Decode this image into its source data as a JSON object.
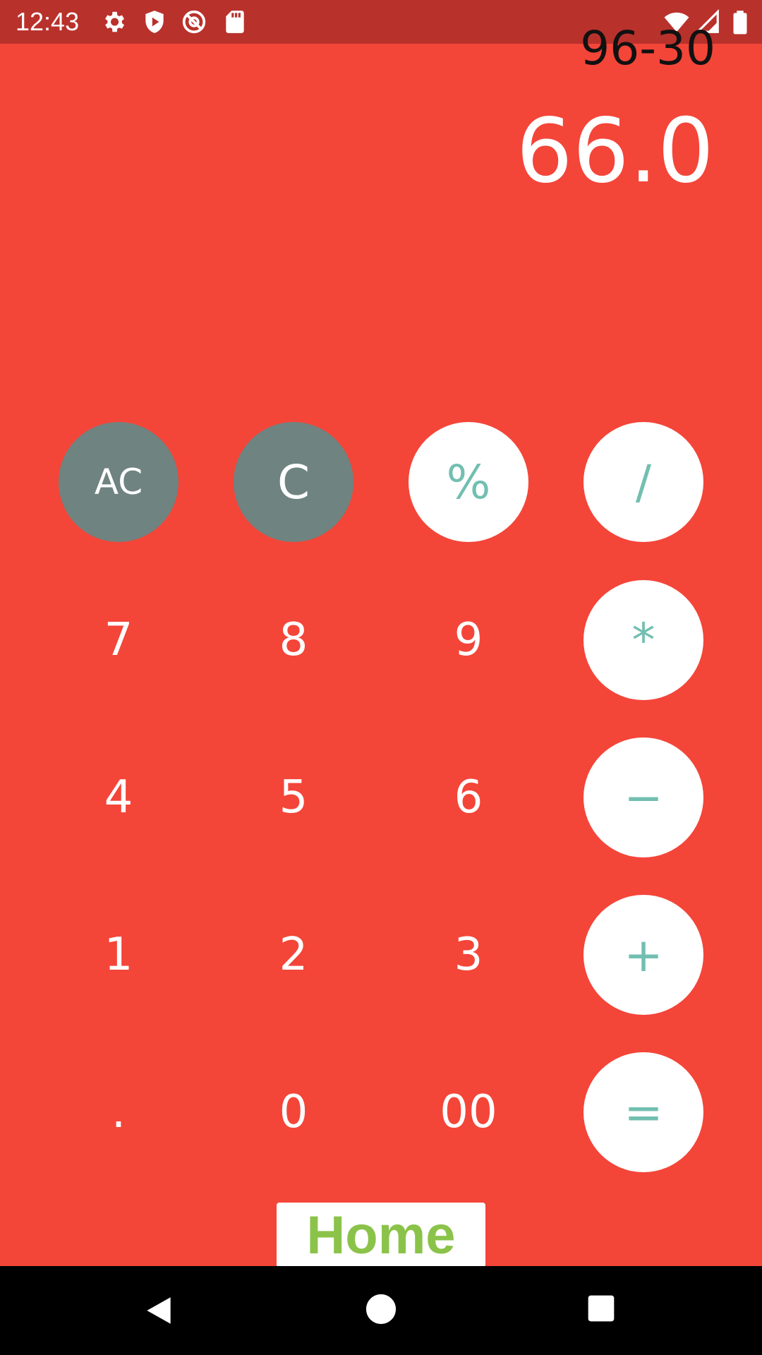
{
  "status_bar": {
    "time": "12:43",
    "left_icons": [
      "gear-icon",
      "shield-play-icon",
      "at-sign-icon",
      "sd-card-icon"
    ],
    "right_icons": [
      "wifi-icon",
      "cell-signal-icon",
      "battery-icon"
    ]
  },
  "display": {
    "expression": "96-30",
    "result": "66.0"
  },
  "keypad": {
    "rows": [
      [
        "AC",
        "C",
        "%",
        "/"
      ],
      [
        "7",
        "8",
        "9",
        "*"
      ],
      [
        "4",
        "5",
        "6",
        "−"
      ],
      [
        "1",
        "2",
        "3",
        "+"
      ],
      [
        ".",
        "0",
        "00",
        "="
      ]
    ]
  },
  "home_button": {
    "label": "Home"
  },
  "nav_bar": {
    "icons": [
      "back-icon",
      "home-circle-icon",
      "recents-icon"
    ]
  },
  "colors": {
    "background": "#f44539",
    "status_bar": "#b9312b",
    "gray_key": "#6f8380",
    "operator_text": "#72bfb1",
    "home_text": "#8bc34a"
  }
}
